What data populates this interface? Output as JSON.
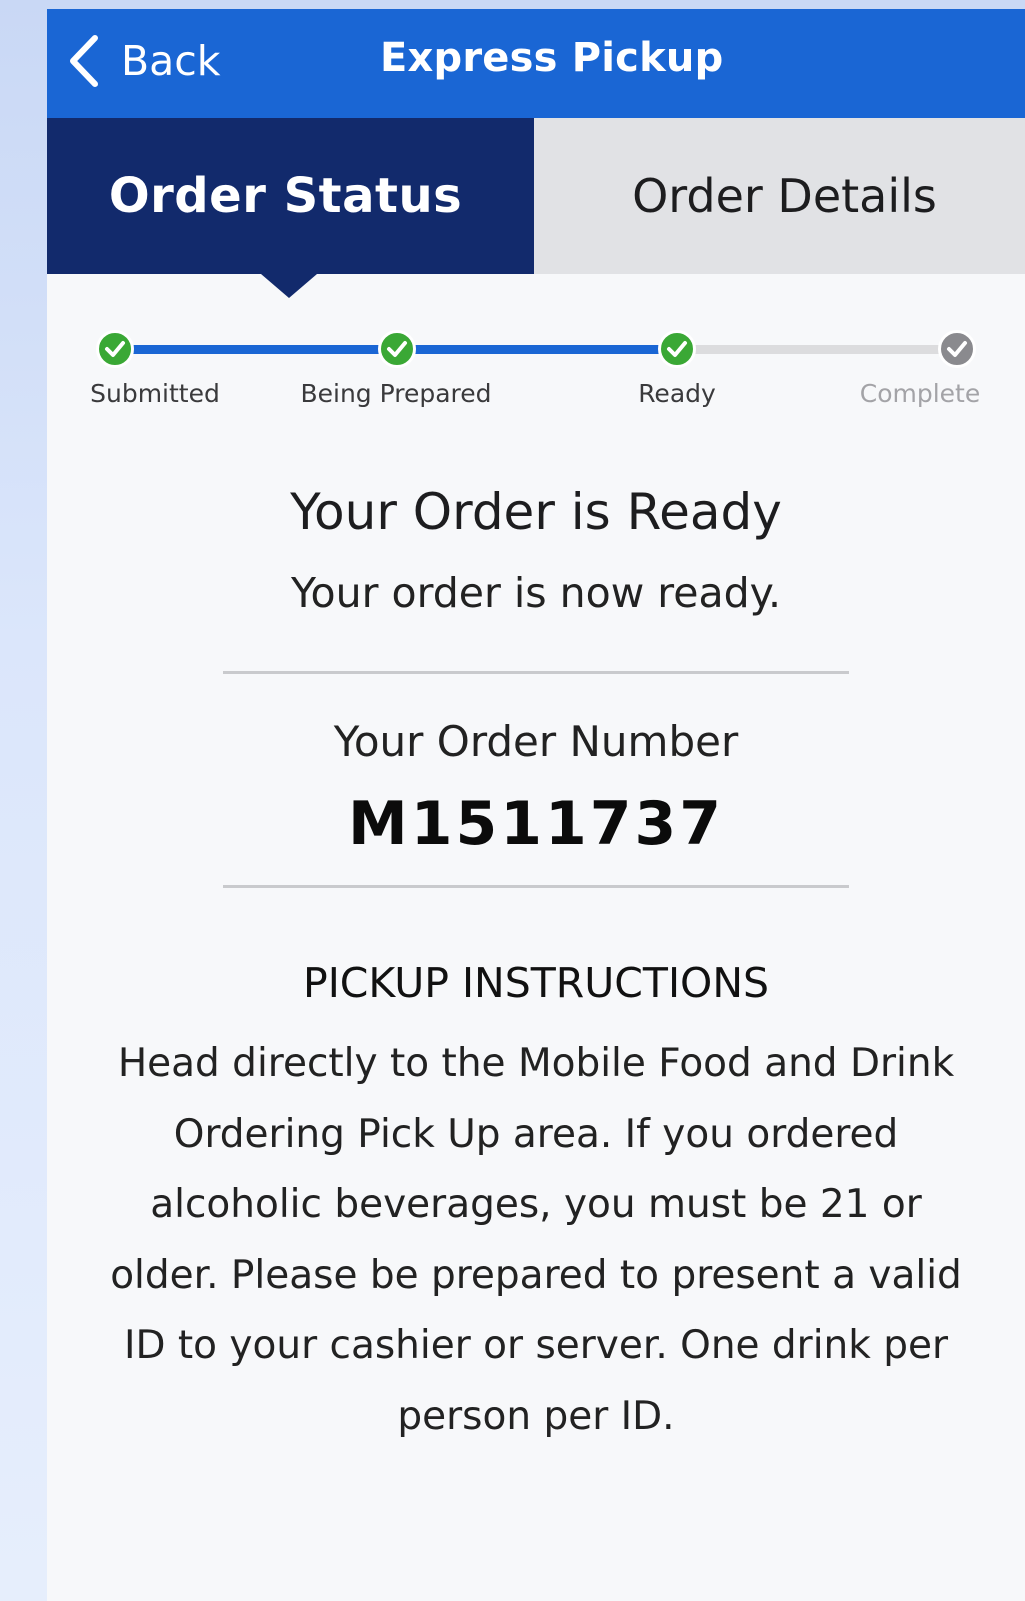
{
  "navbar": {
    "back_label": "Back",
    "title": "Express Pickup"
  },
  "tabs": [
    {
      "label": "Order Status",
      "active": true
    },
    {
      "label": "Order Details",
      "active": false
    }
  ],
  "progress": {
    "steps": [
      {
        "label": "Submitted",
        "state": "done"
      },
      {
        "label": "Being Prepared",
        "state": "done"
      },
      {
        "label": "Ready",
        "state": "done"
      },
      {
        "label": "Complete",
        "state": "pending"
      }
    ],
    "current_step": "Ready"
  },
  "status": {
    "title": "Your Order is Ready",
    "subtitle": "Your order is now ready."
  },
  "order": {
    "label": "Your Order Number",
    "number": "M1511737"
  },
  "instructions": {
    "title": "PICKUP INSTRUCTIONS",
    "body": "Head directly to the Mobile Food and Drink Ordering Pick Up area. If you ordered alcoholic beverages, you must be 21 or older.  Please be prepared to present a valid ID to your cashier or server. One drink per person per ID."
  },
  "colors": {
    "nav_blue": "#1a66d4",
    "active_tab": "#122a6c",
    "inactive_tab": "#e1e2e5",
    "progress_blue": "#1a66d4",
    "check_green": "#3aa835",
    "pending_gray": "#8a8a8e"
  },
  "icons": {
    "back": "chevron-left-icon",
    "step_done": "check-circle-icon",
    "step_pending": "check-circle-icon"
  }
}
